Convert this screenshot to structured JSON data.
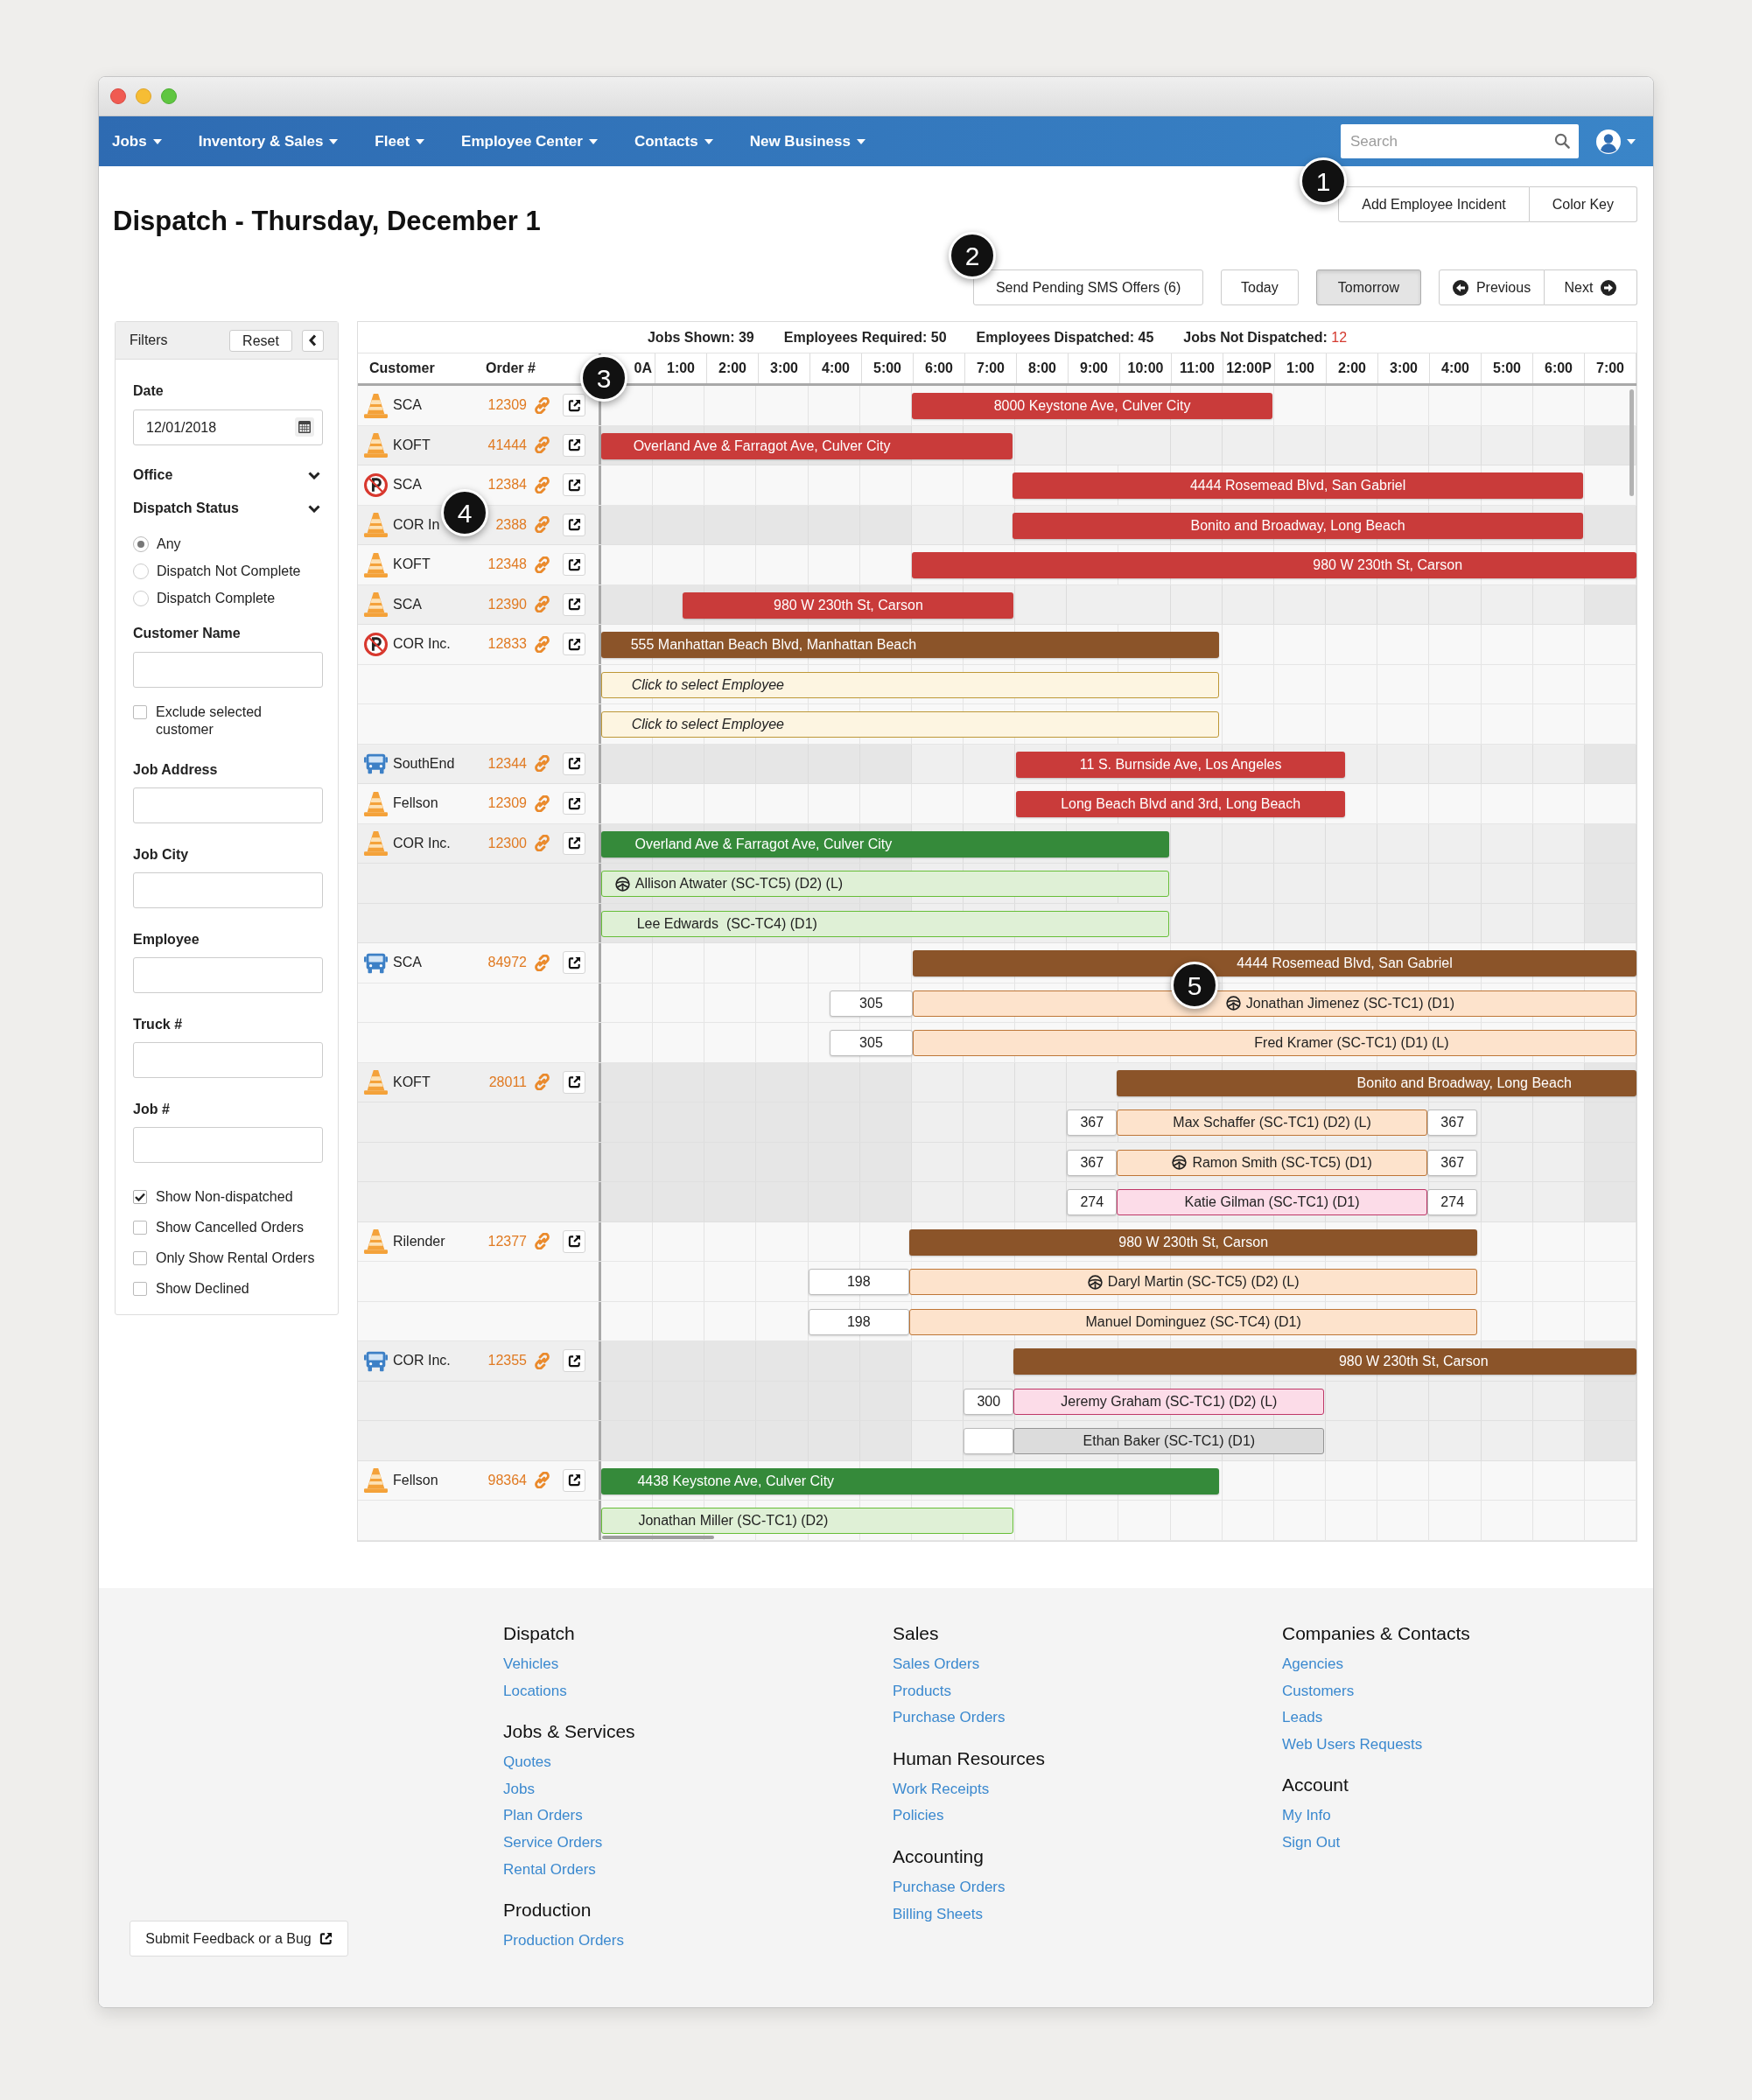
{
  "nav": {
    "items": [
      {
        "label": "Jobs"
      },
      {
        "label": "Inventory & Sales"
      },
      {
        "label": "Fleet"
      },
      {
        "label": "Employee Center"
      },
      {
        "label": "Contacts"
      },
      {
        "label": "New Business"
      }
    ],
    "search": {
      "placeholder": "Search"
    }
  },
  "header": {
    "title": "Dispatch - Thursday, December 1",
    "actions": [
      "Add Employee Incident",
      "Color Key"
    ],
    "sms_button": "Send Pending SMS Offers (6)",
    "days": [
      {
        "label": "Today",
        "selected": false
      },
      {
        "label": "Tomorrow",
        "selected": true
      }
    ],
    "previous": "Previous",
    "next": "Next"
  },
  "filters": {
    "title": "Filters",
    "reset": "Reset",
    "date": {
      "label": "Date",
      "value": "12/01/2018"
    },
    "sections": [
      {
        "label": "Office"
      },
      {
        "label": "Dispatch Status",
        "options": [
          {
            "label": "Any",
            "selected": true
          },
          {
            "label": "Dispatch Not Complete",
            "selected": false
          },
          {
            "label": "Dispatch Complete",
            "selected": false
          }
        ]
      }
    ],
    "customer": {
      "label": "Customer Name"
    },
    "exclude": {
      "label": "Exclude selected customer",
      "checked": false
    },
    "fields": [
      {
        "label": "Job Address"
      },
      {
        "label": "Job City"
      },
      {
        "label": "Employee"
      },
      {
        "label": "Truck #"
      },
      {
        "label": "Job #"
      }
    ],
    "options": [
      {
        "label": "Show Non-dispatched",
        "checked": true
      },
      {
        "label": "Show Cancelled Orders",
        "checked": false
      },
      {
        "label": "Only Show Rental Orders",
        "checked": false
      },
      {
        "label": "Show Declined",
        "checked": false
      }
    ]
  },
  "board": {
    "stats": [
      {
        "label": "Jobs Shown:",
        "value": "39",
        "alert": false
      },
      {
        "label": "Employees Required:",
        "value": "50",
        "alert": false
      },
      {
        "label": "Employees Dispatched:",
        "value": "45",
        "alert": false
      },
      {
        "label": "Jobs Not Dispatched:",
        "value": "12",
        "alert": true
      }
    ],
    "columns": [
      "Customer",
      "Order #"
    ],
    "hours": [
      "0A",
      "1:00",
      "2:00",
      "3:00",
      "4:00",
      "5:00",
      "6:00",
      "7:00",
      "8:00",
      "9:00",
      "10:00",
      "11:00",
      "12:00P",
      "1:00",
      "2:00",
      "3:00",
      "4:00",
      "5:00",
      "6:00",
      "7:00"
    ],
    "jobs": [
      {
        "customer": "SCA",
        "order": "12309",
        "kind": "cone",
        "bar": {
          "text": "8000 Keystone Ave, Culver City",
          "color": "#c93b3a"
        }
      },
      {
        "customer": "KOFT",
        "order": "41444",
        "kind": "cone",
        "bar": {
          "text": "Overland Ave & Farragot Ave, Culver City",
          "color": "#c93b3a"
        }
      },
      {
        "customer": "SCA",
        "order": "12384",
        "kind": "parking",
        "bar": {
          "text": "4444 Rosemead Blvd, San Gabriel",
          "color": "#c93b3a"
        }
      },
      {
        "customer": "COR In",
        "order": "2388",
        "kind": "cone",
        "bar": {
          "text": "Bonito and Broadway, Long Beach",
          "color": "#c93b3a"
        }
      },
      {
        "customer": "KOFT",
        "order": "12348",
        "kind": "cone",
        "bar": {
          "text": "980 W 230th St, Carson",
          "color": "#c93b3a"
        }
      },
      {
        "customer": "SCA",
        "order": "12390",
        "kind": "cone",
        "bar": {
          "text": "980 W 230th St, Carson",
          "color": "#c93b3a"
        }
      },
      {
        "customer": "COR Inc.",
        "order": "12833",
        "kind": "parking",
        "bar": {
          "text": "555 Manhattan Beach Blvd, Manhattan Beach",
          "color": "#8b5429"
        },
        "assignments": [
          {
            "text": "Click to select Employee",
            "color": "#fdf5e1",
            "assigned": false,
            "driver": false,
            "left_box": false,
            "right_box": false
          },
          {
            "text": "Click to select Employee",
            "color": "#fdf5e1",
            "assigned": false,
            "driver": false,
            "left_box": false,
            "right_box": false
          }
        ]
      },
      {
        "customer": "SouthEnd",
        "order": "12344",
        "kind": "bus",
        "bar": {
          "text": "11 S. Burnside Ave, Los Angeles",
          "color": "#c93b3a"
        }
      },
      {
        "customer": "Fellson",
        "order": "12309",
        "kind": "cone",
        "bar": {
          "text": "Long Beach Blvd and 3rd, Long Beach",
          "color": "#c93b3a"
        }
      },
      {
        "customer": "COR Inc.",
        "order": "12300",
        "kind": "cone",
        "bar": {
          "text": "Overland Ave & Farragot Ave, Culver City",
          "color": "#358a3a"
        },
        "assignments": [
          {
            "text": "Allison Atwater (SC-TC5) (D2) (L)",
            "color": "#dff0d6",
            "assigned": true,
            "driver": true,
            "left_box": false,
            "right_box": false
          },
          {
            "text": "Lee Edwards  (SC-TC4) (D1)",
            "color": "#dff0d6",
            "assigned": true,
            "driver": false,
            "left_box": false,
            "right_box": false
          }
        ]
      },
      {
        "customer": "SCA",
        "order": "84972",
        "kind": "bus",
        "bar": {
          "text": "4444 Rosemead Blvd, San Gabriel",
          "color": "#8b5429"
        },
        "assignments": [
          {
            "text": "Jonathan Jimenez (SC-TC1) (D1)",
            "color": "#fde3cc",
            "assigned": true,
            "driver": true,
            "left_box": true,
            "left_number": "305",
            "right_box": false
          },
          {
            "text": "Fred Kramer (SC-TC1) (D1) (L)",
            "color": "#fde3cc",
            "assigned": true,
            "driver": false,
            "left_box": true,
            "left_number": "305",
            "right_box": false
          }
        ]
      },
      {
        "customer": "KOFT",
        "order": "28011",
        "kind": "cone",
        "bar": {
          "text": "Bonito and Broadway, Long Beach",
          "color": "#8b5429"
        },
        "assignments": [
          {
            "text": "Max Schaffer (SC-TC1) (D2) (L)",
            "color": "#fde3cc",
            "assigned": true,
            "driver": false,
            "left_box": true,
            "left_number": "367",
            "right_box": true,
            "right_number": "367"
          },
          {
            "text": "Ramon Smith (SC-TC5) (D1)",
            "color": "#fde3cc",
            "assigned": true,
            "driver": true,
            "left_box": true,
            "left_number": "367",
            "right_box": true,
            "right_number": "367"
          },
          {
            "text": "Katie Gilman (SC-TC1) (D1)",
            "color": "#fcdce8",
            "assigned": true,
            "driver": false,
            "left_box": true,
            "left_number": "274",
            "right_box": true,
            "right_number": "274"
          }
        ]
      },
      {
        "customer": "Rilender",
        "order": "12377",
        "kind": "cone",
        "bar": {
          "text": "980 W 230th St, Carson",
          "color": "#8b5429"
        },
        "assignments": [
          {
            "text": "Daryl Martin (SC-TC5) (D2) (L)",
            "color": "#fde3cc",
            "assigned": true,
            "driver": true,
            "left_box": true,
            "left_number": "198",
            "right_box": false
          },
          {
            "text": "Manuel Dominguez (SC-TC4) (D1)",
            "color": "#fde3cc",
            "assigned": true,
            "driver": false,
            "left_box": true,
            "left_number": "198",
            "right_box": false
          }
        ]
      },
      {
        "customer": "COR Inc.",
        "order": "12355",
        "kind": "bus",
        "bar": {
          "text": "980 W 230th St, Carson",
          "color": "#8b5429"
        },
        "assignments": [
          {
            "text": "Jeremy Graham (SC-TC1) (D2) (L)",
            "color": "#fcdce8",
            "assigned": true,
            "driver": false,
            "left_box": true,
            "left_number": "300",
            "right_box": false
          },
          {
            "text": "Ethan Baker (SC-TC1) (D1)",
            "color": "#dcdcdc",
            "assigned": true,
            "driver": false,
            "left_box": true,
            "right_box": false
          }
        ]
      },
      {
        "customer": "Fellson",
        "order": "98364",
        "kind": "cone",
        "bar": {
          "text": "4438 Keystone Ave, Culver City",
          "color": "#358a3a"
        },
        "assignments": [
          {
            "text": "Jonathan Miller (SC-TC1) (D2)",
            "color": "#dff0d6",
            "assigned": true,
            "driver": false,
            "left_box": false,
            "right_box": false
          }
        ]
      }
    ]
  },
  "footer": {
    "columns": [
      {
        "sections": [
          {
            "heading": "Dispatch",
            "links": [
              "Vehicles",
              "Locations"
            ]
          },
          {
            "heading": "Jobs & Services",
            "links": [
              "Quotes",
              "Jobs",
              "Plan Orders",
              "Service Orders",
              "Rental Orders"
            ]
          },
          {
            "heading": "Production",
            "links": [
              "Production Orders"
            ]
          }
        ]
      },
      {
        "sections": [
          {
            "heading": "Sales",
            "links": [
              "Sales Orders",
              "Products",
              "Purchase Orders"
            ]
          },
          {
            "heading": "Human Resources",
            "links": [
              "Work Receipts",
              "Policies"
            ]
          },
          {
            "heading": "Accounting",
            "links": [
              "Purchase Orders",
              "Billing Sheets"
            ]
          }
        ]
      },
      {
        "sections": [
          {
            "heading": "Companies & Contacts",
            "links": [
              "Agencies",
              "Customers",
              "Leads",
              "Web Users Requests"
            ]
          },
          {
            "heading": "Account",
            "links": [
              "My Info",
              "Sign Out"
            ]
          }
        ]
      }
    ],
    "feedback": "Submit Feedback or a Bug"
  },
  "callouts": [
    {
      "label": "1"
    },
    {
      "label": "2"
    },
    {
      "label": "3"
    },
    {
      "label": "4"
    },
    {
      "label": "5"
    }
  ]
}
